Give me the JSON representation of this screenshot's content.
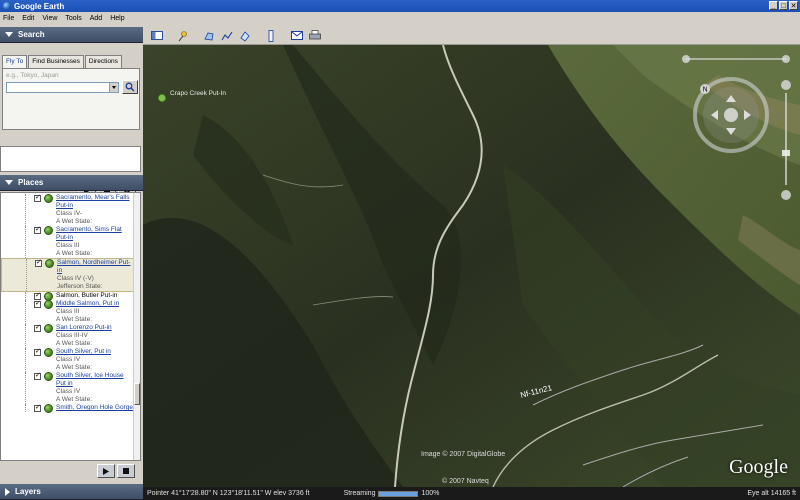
{
  "window": {
    "title": "Google Earth",
    "controls": [
      "_",
      "□",
      "✕"
    ]
  },
  "menu": [
    "File",
    "Edit",
    "View",
    "Tools",
    "Add",
    "Help"
  ],
  "search": {
    "header": "Search",
    "tabs": [
      "Fly To",
      "Find Businesses",
      "Directions"
    ],
    "placeholder": "e.g., Tokyo, Japan",
    "value": ""
  },
  "places": {
    "header": "Places",
    "items": [
      {
        "title": "Sacramento, Mear's Falls Put-in",
        "lines": [
          "Class IV-",
          "A Wet State:"
        ]
      },
      {
        "title": "Sacramento, Sims Flat Put-in",
        "lines": [
          "Class III",
          "A Wet State:"
        ]
      },
      {
        "title": "Salmon, Nordheimer Put-in",
        "lines": [
          "Class IV (-V)",
          "Jefferson State:"
        ],
        "selected": true
      },
      {
        "title": "Salmon, Butler Put-in",
        "lines": [],
        "plain": true
      },
      {
        "title": "Middle Salmon, Put in",
        "lines": [
          "Class III",
          "A Wet State:"
        ]
      },
      {
        "title": "San Lorenzo Put-in",
        "lines": [
          "Class III-IV",
          "A Wet State:"
        ]
      },
      {
        "title": "South Silver, Put in",
        "lines": [
          "Class IV",
          "A Wet State:"
        ]
      },
      {
        "title": "South Silver, Ice House Put in",
        "lines": [
          "Class IV",
          "A Wet State:"
        ]
      },
      {
        "title": "Smith, Oregon Hole Gorge",
        "lines": []
      }
    ]
  },
  "layers": {
    "header": "Layers"
  },
  "map": {
    "placemark": "Crapo Creek Put-In",
    "road_label": "Nf-11n21",
    "credit_image": "Image © 2007 DigitalGlobe",
    "credit_map": "© 2007 Navteq",
    "logo": "Google"
  },
  "status": {
    "pointer": "Pointer  41°17'28.80\" N   123°18'11.51\" W   elev  3736 ft",
    "streaming_label": "Streaming",
    "streaming_percent": 100,
    "streaming_text": "100%",
    "eye_alt": "Eye alt     14165 ft"
  }
}
